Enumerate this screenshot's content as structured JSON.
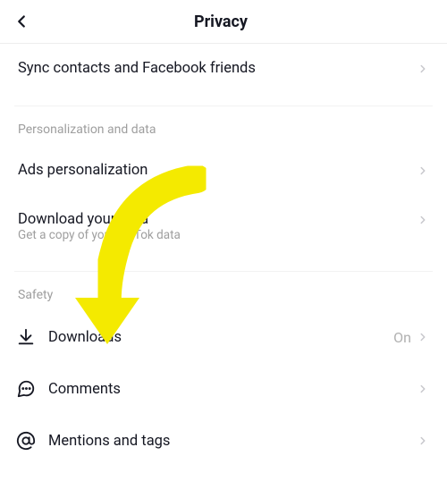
{
  "header": {
    "title": "Privacy"
  },
  "rows": {
    "sync": {
      "label": "Sync contacts and Facebook friends"
    },
    "ads": {
      "label": "Ads personalization"
    },
    "download_data": {
      "label": "Download your data",
      "subtitle": "Get a copy of your TikTok data"
    },
    "downloads": {
      "label": "Downloads",
      "value": "On"
    },
    "comments": {
      "label": "Comments"
    },
    "mentions": {
      "label": "Mentions and tags"
    }
  },
  "sections": {
    "personalization": "Personalization and data",
    "safety": "Safety"
  }
}
